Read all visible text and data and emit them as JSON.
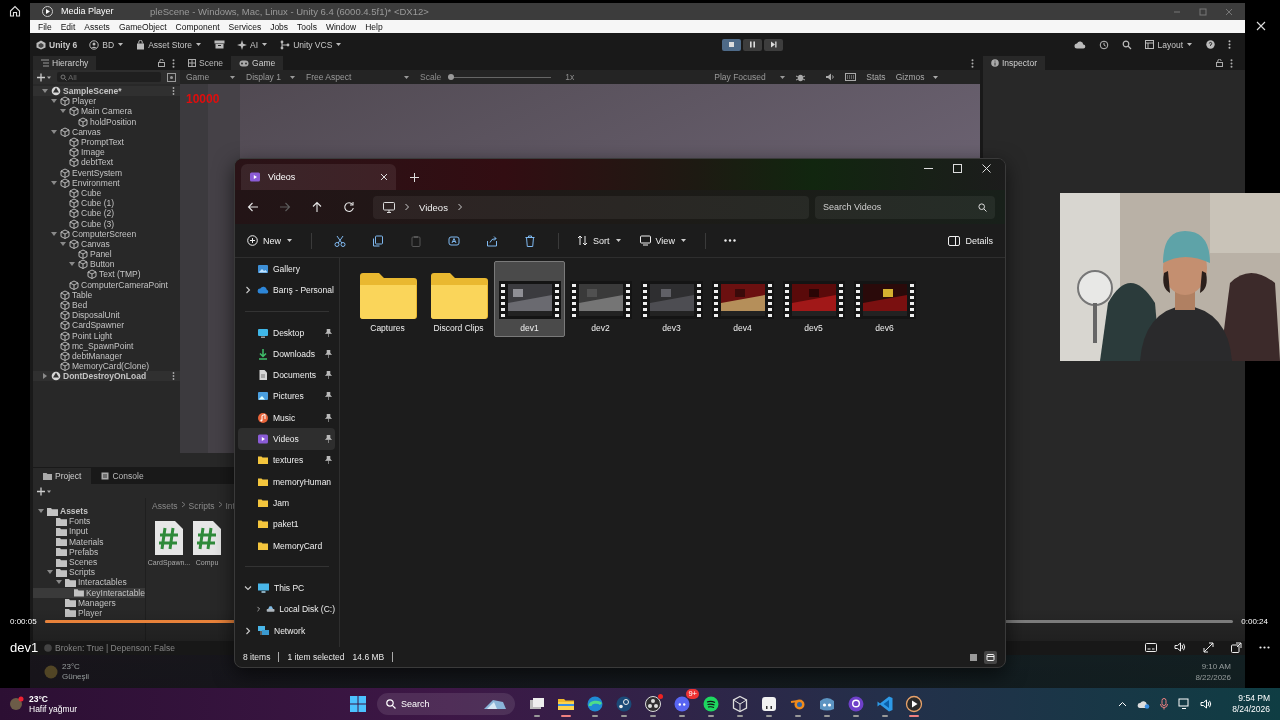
{
  "media_player": {
    "title": "Media Player",
    "elapsed": "0:00:05",
    "duration": "0:00:24",
    "progress": {
      "level": 0.16
    },
    "video_title": "dev1"
  },
  "video_frame": {
    "unity": {
      "window_title": "pleScene - Windows, Mac, Linux - Unity 6.4 (6000.4.5f1)* <DX12>",
      "menu": [
        "File",
        "Edit",
        "Assets",
        "GameObject",
        "Component",
        "Services",
        "Jobs",
        "Tools",
        "Window",
        "Help"
      ],
      "toolbar": [
        {
          "kind": "unity",
          "label": "Unity 6"
        },
        {
          "kind": "account",
          "label": "BD"
        },
        {
          "kind": "store",
          "label": "Asset Store"
        },
        {
          "kind": "package"
        },
        {
          "kind": "ai",
          "label": "AI"
        },
        {
          "kind": "vcs",
          "label": "Unity VCS"
        }
      ],
      "play_controls": [
        {
          "kind": "stop",
          "on": true
        },
        {
          "kind": "pause",
          "on": false
        },
        {
          "kind": "step",
          "on": false
        }
      ],
      "layout_menu": "Layout",
      "hierarchy": {
        "title": "Hierarchy",
        "search_placeholder": "All",
        "tree": [
          {
            "label": "SampleScene*",
            "kind": "scene",
            "expanded": true,
            "children": [
              {
                "label": "Player",
                "kind": "object",
                "expanded": true,
                "children": [
                  {
                    "label": "Main Camera",
                    "kind": "object",
                    "expanded": true,
                    "children": [
                      {
                        "label": "holdPosition",
                        "kind": "object"
                      }
                    ]
                  }
                ]
              },
              {
                "label": "Canvas",
                "kind": "object",
                "expanded": true,
                "children": [
                  {
                    "label": "PromptText",
                    "kind": "object"
                  },
                  {
                    "label": "Image",
                    "kind": "object"
                  },
                  {
                    "label": "debtText",
                    "kind": "object"
                  }
                ]
              },
              {
                "label": "EventSystem",
                "kind": "object"
              },
              {
                "label": "Environment",
                "kind": "object",
                "expanded": true,
                "children": [
                  {
                    "label": "Cube",
                    "kind": "object"
                  },
                  {
                    "label": "Cube (1)",
                    "kind": "object"
                  },
                  {
                    "label": "Cube (2)",
                    "kind": "object"
                  },
                  {
                    "label": "Cube (3)",
                    "kind": "object"
                  }
                ]
              },
              {
                "label": "ComputerScreen",
                "kind": "object",
                "expanded": true,
                "children": [
                  {
                    "label": "Canvas",
                    "kind": "object",
                    "expanded": true,
                    "children": [
                      {
                        "label": "Panel",
                        "kind": "object"
                      },
                      {
                        "label": "Button",
                        "kind": "object",
                        "expanded": true,
                        "children": [
                          {
                            "label": "Text (TMP)",
                            "kind": "object"
                          }
                        ]
                      }
                    ]
                  },
                  {
                    "label": "ComputerCameraPoint",
                    "kind": "object"
                  }
                ]
              },
              {
                "label": "Table",
                "kind": "object"
              },
              {
                "label": "Bed",
                "kind": "object"
              },
              {
                "label": "DisposalUnit",
                "kind": "object"
              },
              {
                "label": "CardSpawner",
                "kind": "object"
              },
              {
                "label": "Point Light",
                "kind": "object"
              },
              {
                "label": "mc_SpawnPoint",
                "kind": "object"
              },
              {
                "label": "debtManager",
                "kind": "object"
              },
              {
                "label": "MemoryCard(Clone)",
                "kind": "object"
              }
            ]
          },
          {
            "label": "DontDestroyOnLoad",
            "kind": "scene",
            "expanded": false
          }
        ]
      },
      "view_tabs": [
        {
          "label": "Scene",
          "kind": "scene",
          "selected": false
        },
        {
          "label": "Game",
          "kind": "game",
          "selected": true
        }
      ],
      "game_bar": {
        "view": "Game",
        "display": "Display 1",
        "aspect": "Free Aspect",
        "scale_label": "Scale",
        "scale": {
          "level": 0
        },
        "scale_value": "1x",
        "play_mode": "Play Focused",
        "stats": "Stats",
        "gizmos": "Gizmos"
      },
      "game_score": "10000",
      "inspector": {
        "title": "Inspector"
      },
      "project": {
        "tabs": [
          {
            "label": "Project",
            "selected": true
          },
          {
            "label": "Console",
            "selected": false
          }
        ],
        "tree": [
          {
            "label": "Assets",
            "selected": false,
            "expanded": true,
            "children": [
              {
                "label": "Fonts",
                "selected": false
              },
              {
                "label": "Input",
                "selected": false
              },
              {
                "label": "Materials",
                "selected": false
              },
              {
                "label": "Prefabs",
                "selected": false
              },
              {
                "label": "Scenes",
                "selected": false
              },
              {
                "label": "Scripts",
                "selected": false,
                "expanded": true,
                "children": [
                  {
                    "label": "Interactables",
                    "selected": false,
                    "expanded": true,
                    "children": [
                      {
                        "label": "KeyInteractable",
                        "selected": true
                      }
                    ]
                  },
                  {
                    "label": "Managers",
                    "selected": false
                  },
                  {
                    "label": "Player",
                    "selected": false
                  }
                ]
              }
            ]
          }
        ],
        "breadcrumb": [
          "Assets",
          "Scripts",
          "Int"
        ],
        "files": [
          {
            "name": "CardSpawn..."
          },
          {
            "name": "Compu"
          }
        ]
      },
      "status": "Broken: True | Depenson: False",
      "taskbar": {
        "temperature": "23°C",
        "condition": "Güneşli",
        "time": "9:10 AM",
        "date": "8/22/2026"
      }
    }
  },
  "explorer": {
    "tabs": [
      {
        "label": "Videos",
        "selected": true
      }
    ],
    "nav_buttons": [
      {
        "kind": "back",
        "disabled": false
      },
      {
        "kind": "forward",
        "disabled": true
      },
      {
        "kind": "up",
        "disabled": false
      },
      {
        "kind": "refresh",
        "disabled": false
      }
    ],
    "path": [
      "Videos"
    ],
    "search_placeholder": "Search Videos",
    "new_label": "New",
    "commands": [
      {
        "kind": "cut",
        "disabled": false
      },
      {
        "kind": "copy",
        "disabled": false
      },
      {
        "kind": "paste",
        "disabled": true
      },
      {
        "kind": "rename",
        "disabled": false
      },
      {
        "kind": "share",
        "disabled": false
      },
      {
        "kind": "delete",
        "disabled": false
      }
    ],
    "sort_label": "Sort",
    "view_label": "View",
    "details_label": "Details",
    "nav_groups": [
      [
        {
          "label": "Gallery",
          "kind": "gallery",
          "selected": false
        },
        {
          "label": "Barış - Personal",
          "kind": "cloud",
          "selected": false,
          "expanded": false
        }
      ],
      [
        {
          "label": "Desktop",
          "kind": "desktop",
          "selected": false,
          "pinned": true
        },
        {
          "label": "Downloads",
          "kind": "downloads",
          "selected": false,
          "pinned": true
        },
        {
          "label": "Documents",
          "kind": "documents",
          "selected": false,
          "pinned": true
        },
        {
          "label": "Pictures",
          "kind": "pictures",
          "selected": false,
          "pinned": true
        },
        {
          "label": "Music",
          "kind": "music",
          "selected": false,
          "pinned": true
        },
        {
          "label": "Videos",
          "kind": "videos",
          "selected": true,
          "pinned": true
        },
        {
          "label": "textures",
          "kind": "folder",
          "selected": false,
          "pinned": true
        },
        {
          "label": "memoryHuman",
          "kind": "folder",
          "selected": false,
          "pinned": false
        },
        {
          "label": "Jam",
          "kind": "folder",
          "selected": false,
          "pinned": false
        },
        {
          "label": "paket1",
          "kind": "folder",
          "selected": false,
          "pinned": false
        },
        {
          "label": "MemoryCard",
          "kind": "folder",
          "selected": false,
          "pinned": false
        }
      ],
      [
        {
          "label": "This PC",
          "kind": "pc",
          "selected": false,
          "expanded": true,
          "children": [
            {
              "label": "Local Disk (C:)",
              "kind": "disk",
              "selected": false,
              "expanded": false
            }
          ]
        },
        {
          "label": "Network",
          "kind": "network",
          "selected": false,
          "expanded": false
        }
      ]
    ],
    "items": [
      {
        "name": "Captures",
        "kind": "folder",
        "selected": false
      },
      {
        "name": "Discord Clips",
        "kind": "folder",
        "selected": false
      },
      {
        "name": "dev1",
        "kind": "video",
        "selected": true
      },
      {
        "name": "dev2",
        "kind": "video",
        "selected": false
      },
      {
        "name": "dev3",
        "kind": "video",
        "selected": false
      },
      {
        "name": "dev4",
        "kind": "video",
        "selected": false
      },
      {
        "name": "dev5",
        "kind": "video",
        "selected": false
      },
      {
        "name": "dev6",
        "kind": "video",
        "selected": false
      }
    ],
    "status": {
      "count": "8 items",
      "selection": "1 item selected",
      "size": "14.6 MB"
    },
    "view_toggles": [
      {
        "kind": "details",
        "selected": false
      },
      {
        "kind": "tiles",
        "selected": true
      }
    ]
  },
  "taskbar": {
    "temperature": "23°C",
    "condition": "Hafif yağmur",
    "search_placeholder": "Search",
    "apps": [
      {
        "kind": "taskview",
        "active": false,
        "notification": false
      },
      {
        "kind": "explorer",
        "active": true,
        "notification": false
      },
      {
        "kind": "edge",
        "active": false,
        "notification": false
      },
      {
        "kind": "steam",
        "active": false,
        "notification": false
      },
      {
        "kind": "obs",
        "active": false,
        "notification": true
      },
      {
        "kind": "discord",
        "active": false,
        "notification": false,
        "badge": "9+"
      },
      {
        "kind": "spotify",
        "active": false,
        "notification": false
      },
      {
        "kind": "unity",
        "active": false,
        "notification": false
      },
      {
        "kind": "tile",
        "active": false,
        "notification": false
      },
      {
        "kind": "blender",
        "active": false,
        "notification": false
      },
      {
        "kind": "godot",
        "active": false,
        "notification": false
      },
      {
        "kind": "github",
        "active": false,
        "notification": false
      },
      {
        "kind": "vscode",
        "active": false,
        "notification": false
      },
      {
        "kind": "mediaplayer",
        "active": true,
        "notification": false
      }
    ],
    "time": "9:54 PM",
    "date": "8/24/2026"
  }
}
